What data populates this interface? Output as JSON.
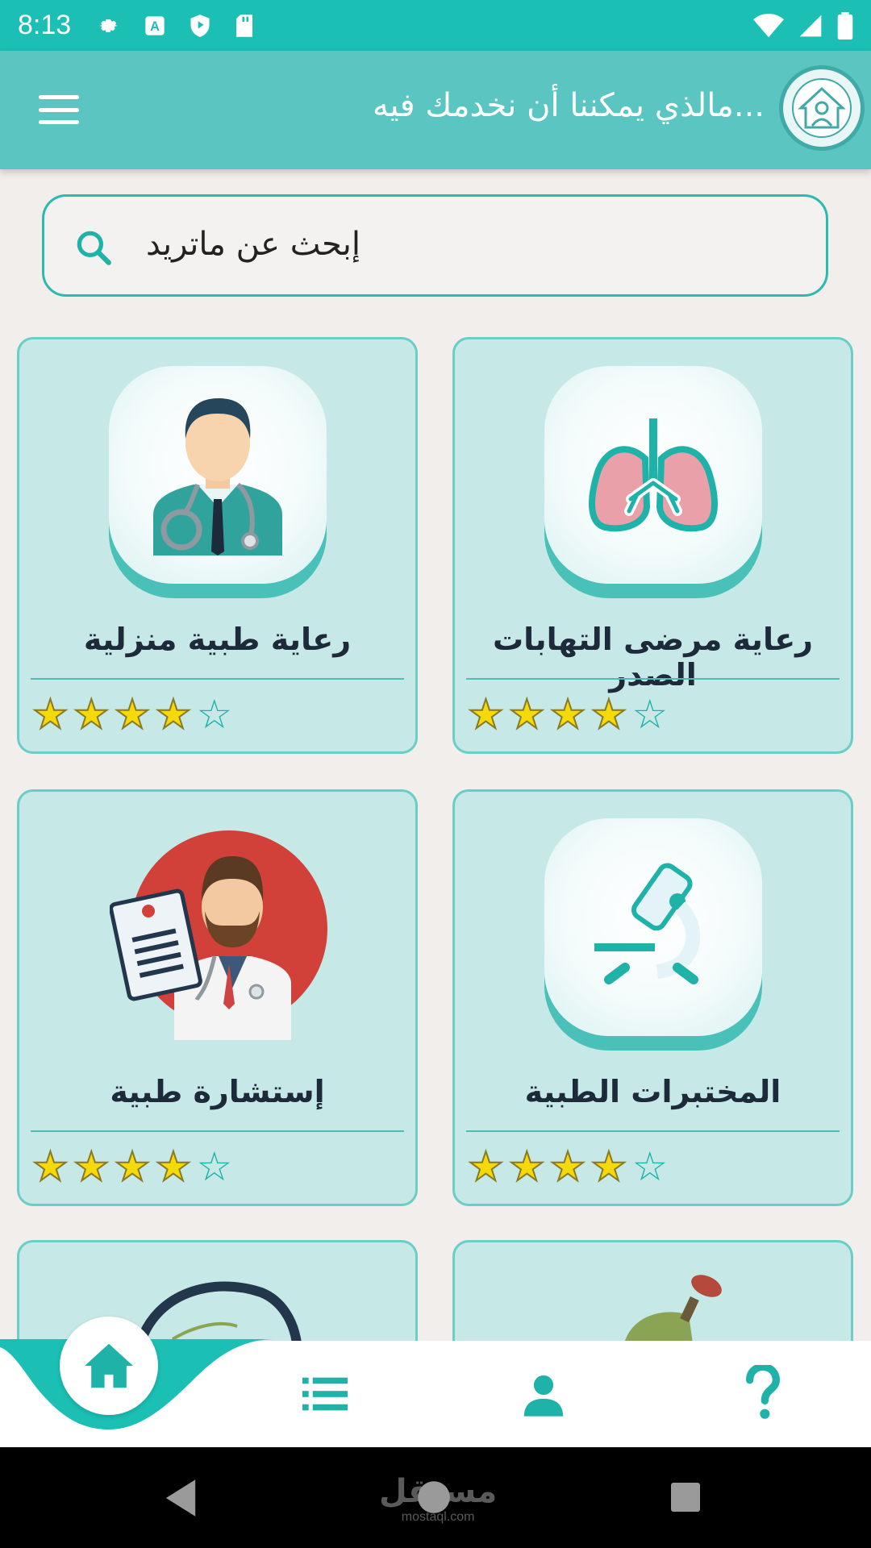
{
  "status": {
    "time": "8:13",
    "left_icons": [
      "settings-icon",
      "a-icon",
      "shield-icon",
      "sd-card-icon"
    ],
    "right_icons": [
      "wifi-icon",
      "signal-icon",
      "battery-icon"
    ]
  },
  "header": {
    "title": "...مالذي يمكننا أن نخدمك فيه",
    "menu_icon": "hamburger-icon",
    "logo_icon": "home-care-logo"
  },
  "search": {
    "placeholder": "إبحث عن ماتريد",
    "icon": "search-icon"
  },
  "cards": [
    {
      "title": "رعاية مرضى التهابات الصدر",
      "icon": "lungs-icon",
      "rating": 4,
      "max": 5
    },
    {
      "title": "رعاية طبية منزلية",
      "icon": "doctor-icon",
      "rating": 4,
      "max": 5
    },
    {
      "title": "المختبرات الطبية",
      "icon": "microscope-icon",
      "rating": 4,
      "max": 5
    },
    {
      "title": "إستشارة طبية",
      "icon": "consultation-doctor-icon",
      "rating": 4,
      "max": 5
    },
    {
      "title": "",
      "icon": "oxygen-tank-icon"
    },
    {
      "title": "",
      "icon": "badge-icon"
    }
  ],
  "bottom_nav": [
    "home-icon",
    "list-icon",
    "person-icon",
    "help-icon"
  ],
  "system_nav": {
    "back": "back-icon",
    "home": "home-circle-icon",
    "recent": "recent-icon"
  },
  "watermark": {
    "main": "مستقل",
    "sub": "mostaql.com"
  },
  "colors": {
    "primary": "#1bbfb4",
    "app_bar": "#5bc6c1",
    "card_bg": "#c6e8e6",
    "star": "#f5d90a",
    "star_empty": "#1fb2a9"
  }
}
